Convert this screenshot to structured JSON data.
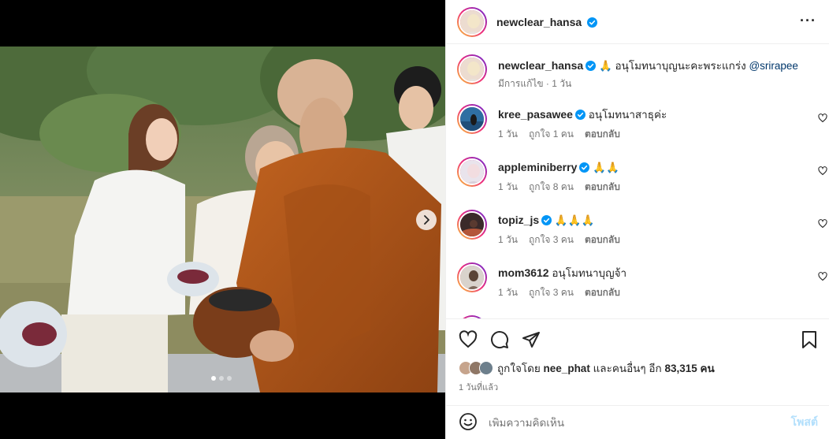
{
  "post": {
    "author": "newclear_hansa",
    "more_label": "···",
    "caption_emoji": "🙏",
    "caption_text": "อนุโมทนาบุญนะคะพระแกร่ง",
    "caption_mention": "@srirapee",
    "caption_meta": "มีการแก้ไข · 1 วัน"
  },
  "comments": [
    {
      "user": "kree_pasawee",
      "verified": true,
      "text": "อนุโมทนาสาธุค่ะ",
      "age": "1 วัน",
      "likes": "ถูกใจ 1 คน",
      "reply": "ตอบกลับ"
    },
    {
      "user": "appleminiberry",
      "verified": true,
      "text": "🙏🙏",
      "age": "1 วัน",
      "likes": "ถูกใจ 8 คน",
      "reply": "ตอบกลับ"
    },
    {
      "user": "topiz_js",
      "verified": true,
      "text": "🙏🙏🙏",
      "age": "1 วัน",
      "likes": "ถูกใจ 3 คน",
      "reply": "ตอบกลับ"
    },
    {
      "user": "mom3612",
      "verified": false,
      "text": "อนุโมทนาบุญจ้า",
      "age": "1 วัน",
      "likes": "ถูกใจ 3 คน",
      "reply": "ตอบกลับ"
    }
  ],
  "likes_bar": {
    "prefix": "ถูกใจโดย",
    "user": "nee_phat",
    "and_others": "และคนอื่นๆ อีก",
    "count": "83,315",
    "unit": "คน"
  },
  "timestamp": "1 วันที่แล้ว",
  "composer": {
    "placeholder": "เพิ่มความคิดเห็น",
    "post_label": "โพสต์"
  },
  "carousel": {
    "slide_count": 3,
    "active_slide": 1
  },
  "colors": {
    "verified": "#0095f6",
    "link": "#00376b",
    "muted": "#737373",
    "post_button": "#b2dffc"
  },
  "icons": [
    "verified-icon",
    "more-icon",
    "heart-icon",
    "comment-icon",
    "share-icon",
    "bookmark-icon",
    "emoji-icon",
    "chevron-right-icon"
  ]
}
